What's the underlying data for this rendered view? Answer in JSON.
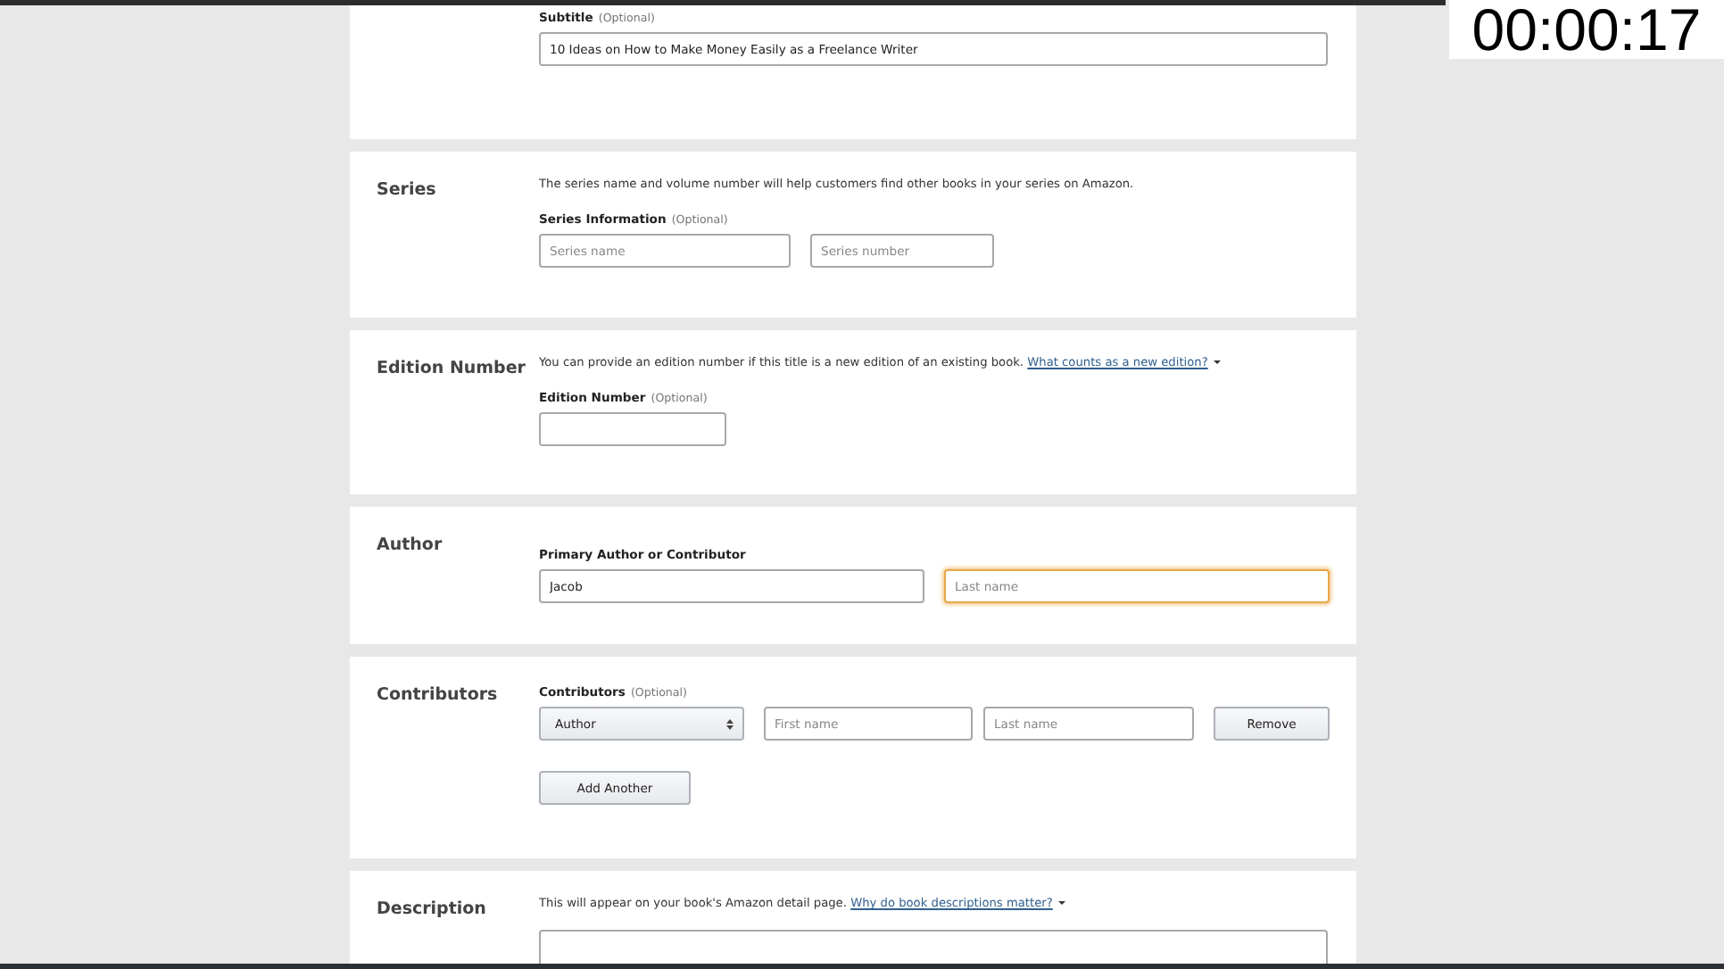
{
  "timer": "00:00:17",
  "sections": [
    {
      "kind": "subtitle",
      "label": "Subtitle",
      "hint": "(Optional)",
      "rows": [
        [
          {
            "kind": "input",
            "value": "10 Ideas on How to Make Money Easily as a Freelance Writer",
            "focused": false
          }
        ]
      ]
    },
    {
      "kind": "series",
      "heading": "Series",
      "description": {
        "text": "The series name and volume number will help customers find other books in your series on Amazon."
      },
      "label": "Series Information",
      "hint": "(Optional)",
      "rows": [
        [
          {
            "kind": "input",
            "placeholder": "Series name",
            "focused": false
          },
          {
            "kind": "input",
            "placeholder": "Series number",
            "focused": false
          }
        ]
      ]
    },
    {
      "kind": "edition",
      "heading": "Edition Number",
      "description": {
        "text": "You can provide an edition number if this title is a new edition of an existing book.",
        "link": "What counts as a new edition?"
      },
      "label": "Edition Number",
      "hint": "(Optional)",
      "rows": [
        [
          {
            "kind": "input",
            "focused": false
          }
        ]
      ]
    },
    {
      "kind": "author",
      "heading": "Author",
      "label": "Primary Author or Contributor",
      "rows": [
        [
          {
            "kind": "input",
            "value": "Jacob",
            "focused": false
          },
          {
            "kind": "input",
            "placeholder": "Last name",
            "focused": true
          }
        ]
      ]
    },
    {
      "kind": "contributors",
      "heading": "Contributors",
      "label": "Contributors",
      "hint": "(Optional)",
      "rows": [
        [
          {
            "kind": "select",
            "value": "Author"
          },
          {
            "kind": "input",
            "placeholder": "First name",
            "focused": false
          },
          {
            "kind": "input",
            "placeholder": "Last name",
            "focused": false
          },
          {
            "kind": "button",
            "label": "Remove"
          }
        ],
        [
          {
            "kind": "button",
            "label": "Add Another"
          }
        ]
      ]
    },
    {
      "kind": "description",
      "heading": "Description",
      "description": {
        "text": "This will appear on your book's Amazon detail page.",
        "link": "Why do book descriptions matter?"
      },
      "rows": [
        [
          {
            "kind": "textarea"
          }
        ]
      ]
    }
  ]
}
